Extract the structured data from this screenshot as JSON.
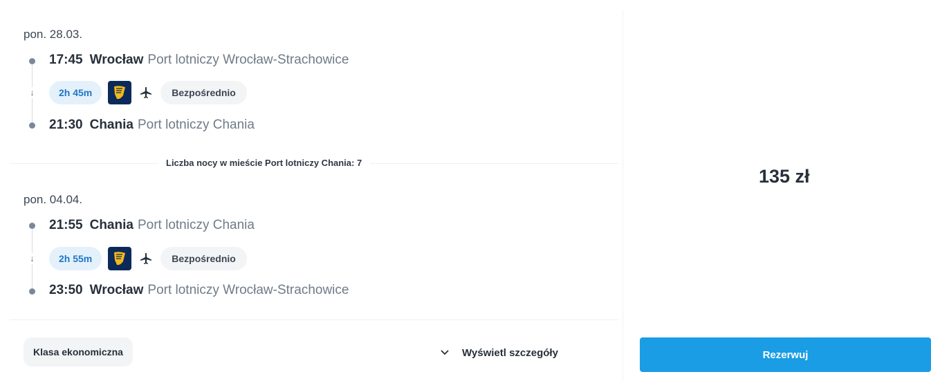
{
  "outbound": {
    "date": "pon. 28.03.",
    "departure": {
      "time": "17:45",
      "city": "Wrocław",
      "airport": "Port lotniczy Wrocław-Strachowice"
    },
    "duration": "2h 45m",
    "stops": "Bezpośrednio",
    "arrival": {
      "time": "21:30",
      "city": "Chania",
      "airport": "Port lotniczy Chania"
    }
  },
  "nights_label": "Liczba nocy w mieście Port lotniczy Chania: 7",
  "inbound": {
    "date": "pon. 04.04.",
    "departure": {
      "time": "21:55",
      "city": "Chania",
      "airport": "Port lotniczy Chania"
    },
    "duration": "2h 55m",
    "stops": "Bezpośrednio",
    "arrival": {
      "time": "23:50",
      "city": "Wrocław",
      "airport": "Port lotniczy Wrocław-Strachowice"
    }
  },
  "fare_class": "Klasa ekonomiczna",
  "details_label": "Wyświetl szczegóły",
  "price": "135 zł",
  "book_label": "Rezerwuj",
  "icons": {
    "carrier": "ryanair-harp-logo",
    "plane": "plane-icon",
    "arrow": "arrow-down-icon",
    "chevron": "chevron-down-icon"
  },
  "colors": {
    "accent": "#1a9de4",
    "duration_badge_bg": "#e4f1fb",
    "duration_badge_text": "#1f76c6",
    "carrier_bg": "#0b2a5a",
    "carrier_gold": "#f2b81c"
  }
}
